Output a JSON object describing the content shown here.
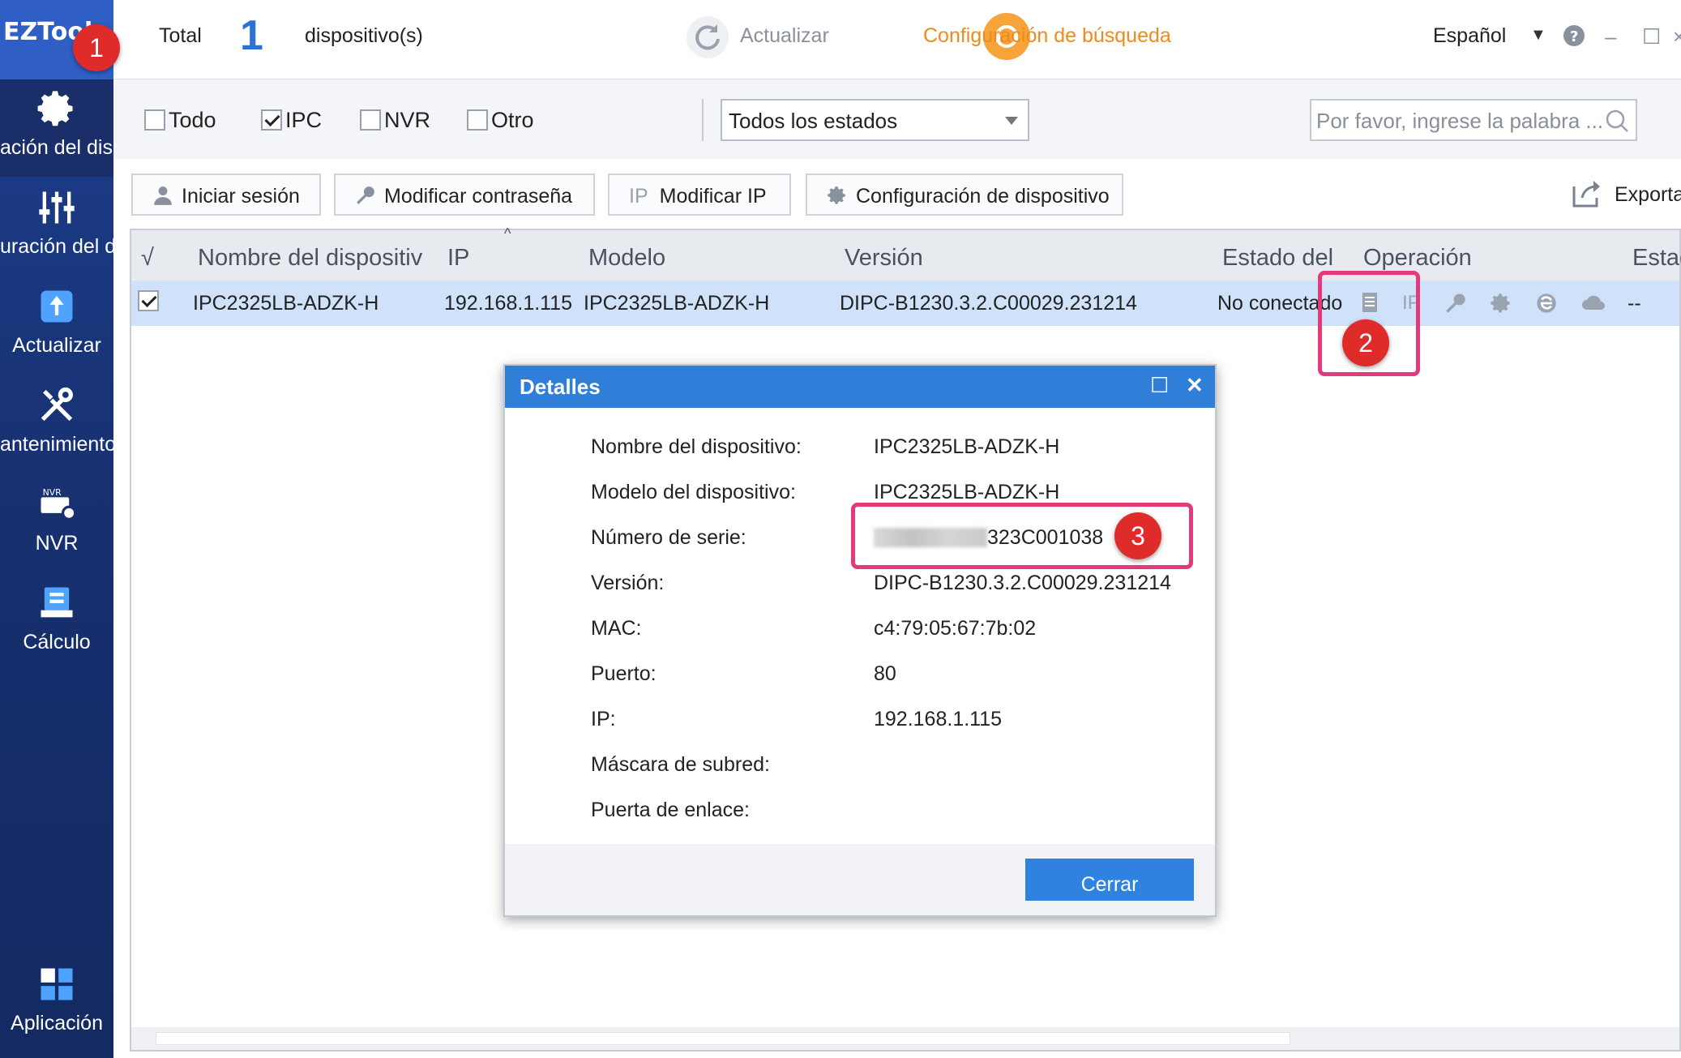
{
  "app": {
    "logo": "EZTools"
  },
  "sidebar": {
    "items": [
      {
        "label": "ación del disp"
      },
      {
        "label": "uración del d"
      },
      {
        "label": "Actualizar"
      },
      {
        "label": "antenimiento"
      },
      {
        "label": "NVR"
      },
      {
        "label": "Cálculo"
      },
      {
        "label": "Aplicación"
      }
    ]
  },
  "topbar": {
    "total_label": "Total",
    "count": "1",
    "devices_label": "dispositivo(s)",
    "refresh_label": "Actualizar",
    "search_config_label": "Configuración de búsqueda",
    "language": "Español"
  },
  "filter": {
    "all": "Todo",
    "ipc": "IPC",
    "nvr": "NVR",
    "other": "Otro",
    "status_select": "Todos los estados",
    "search_placeholder": "Por favor, ingrese la palabra ..."
  },
  "toolbar": {
    "login": "Iniciar sesión",
    "modify_password": "Modificar contraseña",
    "modify_ip": "Modificar IP",
    "ip_icon_text": "IP",
    "device_config": "Configuración de dispositivo",
    "export": "Exportar"
  },
  "table": {
    "headers": {
      "check": "√",
      "name": "Nombre del dispositiv",
      "ip": "IP",
      "model": "Modelo",
      "version": "Versión",
      "status": "Estado del",
      "operation": "Operación",
      "state": "Estad"
    },
    "rows": [
      {
        "name": "IPC2325LB-ADZK-H",
        "ip": "192.168.1.115",
        "model": "IPC2325LB-ADZK-H",
        "version": "DIPC-B1230.3.2.C00029.231214",
        "status": "No conectado",
        "ip_op": "IP",
        "state": "--"
      }
    ]
  },
  "dialog": {
    "title": "Detalles",
    "fields": [
      {
        "label": "Nombre del dispositivo:",
        "value": "IPC2325LB-ADZK-H"
      },
      {
        "label": "Modelo del dispositivo:",
        "value": "IPC2325LB-ADZK-H"
      },
      {
        "label": "Número de serie:",
        "value": "323C001038"
      },
      {
        "label": "Versión:",
        "value": "DIPC-B1230.3.2.C00029.231214"
      },
      {
        "label": "MAC:",
        "value": "c4:79:05:67:7b:02"
      },
      {
        "label": "Puerto:",
        "value": "80"
      },
      {
        "label": "IP:",
        "value": "192.168.1.115"
      },
      {
        "label": "Máscara de subred:",
        "value": ""
      },
      {
        "label": "Puerta de enlace:",
        "value": ""
      }
    ],
    "close_button": "Cerrar"
  },
  "annotations": {
    "badge1": "1",
    "badge2": "2",
    "badge3": "3"
  },
  "colors": {
    "sidebar": "#17306f",
    "accent": "#2f7fd8",
    "highlight": "#e4397a",
    "badge": "#e02b2b",
    "orange": "#f7a43a"
  }
}
